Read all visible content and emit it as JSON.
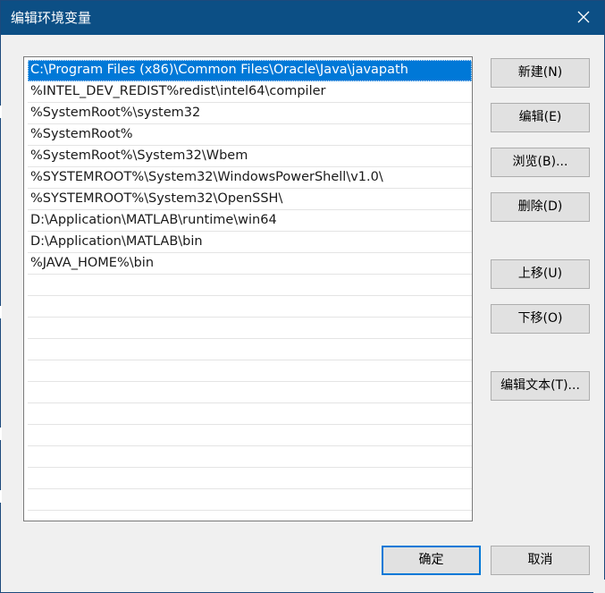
{
  "window": {
    "title": "编辑环境变量",
    "close_icon": "close-icon"
  },
  "list": {
    "items": [
      {
        "text": "C:\\Program Files (x86)\\Common Files\\Oracle\\Java\\javapath",
        "selected": true
      },
      {
        "text": "%INTEL_DEV_REDIST%redist\\intel64\\compiler",
        "selected": false
      },
      {
        "text": "%SystemRoot%\\system32",
        "selected": false
      },
      {
        "text": "%SystemRoot%",
        "selected": false
      },
      {
        "text": "%SystemRoot%\\System32\\Wbem",
        "selected": false
      },
      {
        "text": "%SYSTEMROOT%\\System32\\WindowsPowerShell\\v1.0\\",
        "selected": false
      },
      {
        "text": "%SYSTEMROOT%\\System32\\OpenSSH\\",
        "selected": false
      },
      {
        "text": "D:\\Application\\MATLAB\\runtime\\win64",
        "selected": false
      },
      {
        "text": "D:\\Application\\MATLAB\\bin",
        "selected": false
      },
      {
        "text": "%JAVA_HOME%\\bin",
        "selected": false
      }
    ],
    "empty_row_count": 11
  },
  "buttons": {
    "new": "新建(N)",
    "edit": "编辑(E)",
    "browse": "浏览(B)...",
    "delete": "删除(D)",
    "move_up": "上移(U)",
    "move_down": "下移(O)",
    "edit_text": "编辑文本(T)...",
    "ok": "确定",
    "cancel": "取消"
  },
  "colors": {
    "titlebar": "#0c4f85",
    "selection": "#0078d7",
    "dialog_bg": "#f0f0f0"
  }
}
